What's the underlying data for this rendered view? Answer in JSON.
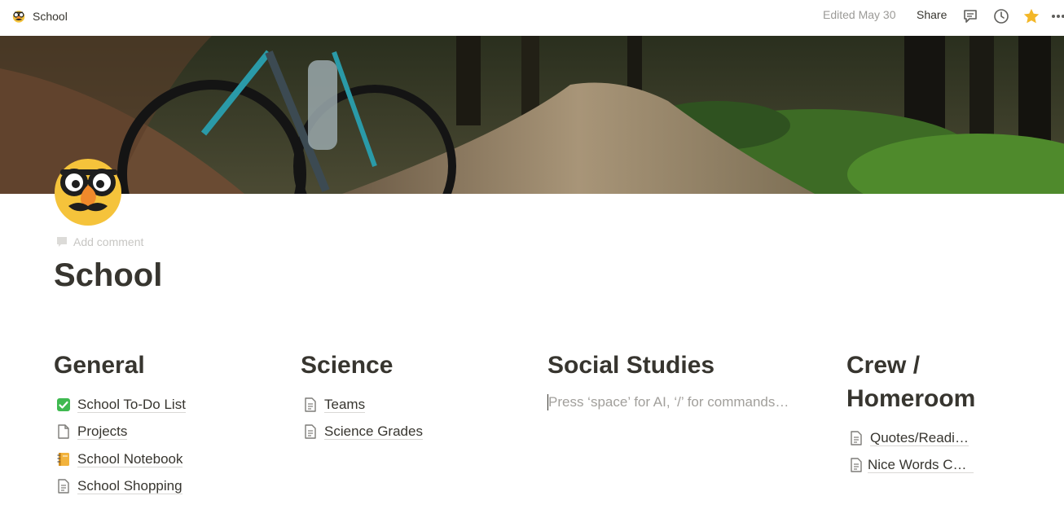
{
  "breadcrumb": {
    "title": "School",
    "icon": "disguise-face-icon"
  },
  "topbar": {
    "edited": "Edited May 30",
    "share_label": "Share",
    "icons": [
      "comments-icon",
      "history-icon",
      "star-icon",
      "more-icon"
    ],
    "star_color": "#f3b728"
  },
  "cover": {
    "description_icon": "cover-image"
  },
  "page": {
    "icon": "disguise-face-icon",
    "add_comment": "Add comment",
    "title": "School"
  },
  "columns": {
    "general": {
      "heading": "General",
      "items": [
        {
          "label": "School To-Do List",
          "icon": "check-box-icon"
        },
        {
          "label": "Projects",
          "icon": "page-icon"
        },
        {
          "label": "School Notebook",
          "icon": "notebook-icon"
        },
        {
          "label": "School Shopping",
          "icon": "document-icon"
        }
      ]
    },
    "science": {
      "heading": "Science",
      "items": [
        {
          "label": "Teams",
          "icon": "document-icon"
        },
        {
          "label": "Science Grades",
          "icon": "document-icon"
        }
      ]
    },
    "social": {
      "heading": "Social Studies",
      "placeholder": "Press ‘space’ for AI, ‘/’ for commands…"
    },
    "crew": {
      "heading_line1": "Crew /",
      "heading_line2": "Homeroom",
      "items": [
        {
          "label": "Quotes/Readi…",
          "icon": "document-icon"
        },
        {
          "label": "Nice Words Co…",
          "icon": "document-icon"
        }
      ]
    }
  }
}
